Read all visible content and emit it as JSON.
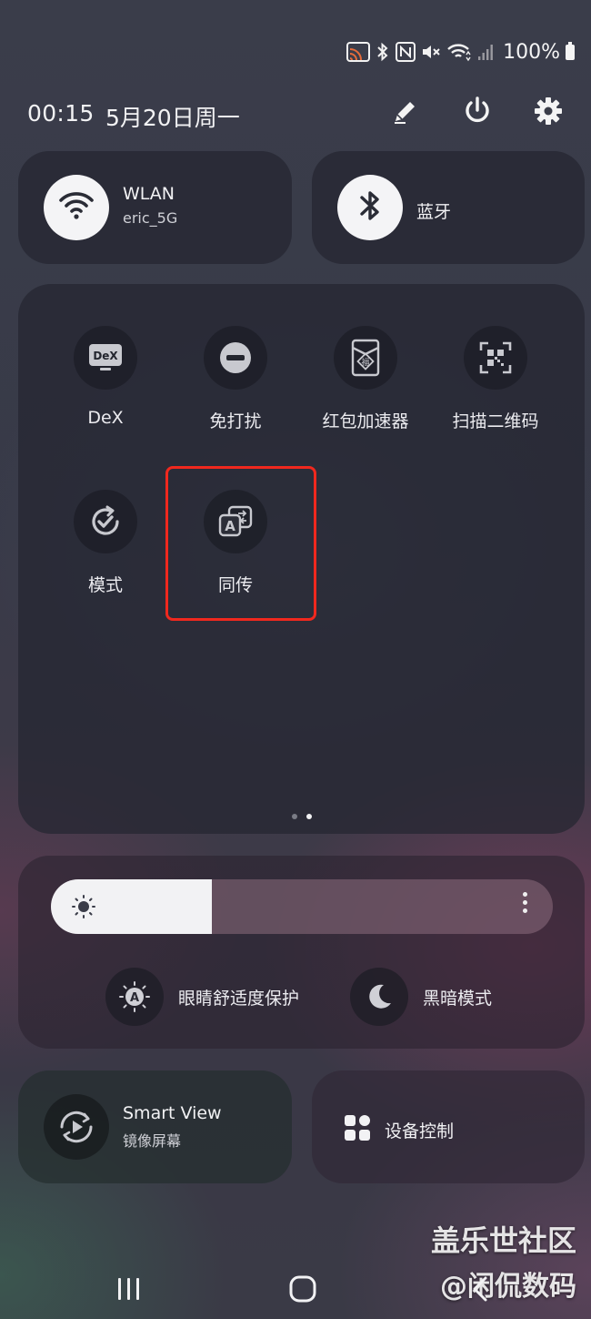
{
  "status_bar": {
    "icons": [
      "cast-icon",
      "bluetooth-icon",
      "nfc-icon",
      "mute-icon",
      "wifi-icon",
      "signal-icon"
    ],
    "battery_text": "100%"
  },
  "header": {
    "time": "00:15",
    "date": "5月20日周一",
    "actions": [
      "pencil-icon",
      "power-icon",
      "gear-icon"
    ]
  },
  "wlan": {
    "title": "WLAN",
    "network": "eric_5G"
  },
  "bluetooth": {
    "title": "蓝牙"
  },
  "quick_tiles": [
    {
      "label": "DeX",
      "icon": "dex-icon",
      "icon_text": "DeX"
    },
    {
      "label": "免打扰",
      "icon": "do-not-disturb-icon"
    },
    {
      "label": "红包加速器",
      "icon": "red-envelope-icon",
      "icon_text": "福"
    },
    {
      "label": "扫描二维码",
      "icon": "qr-scan-icon"
    },
    {
      "label": "模式",
      "icon": "modes-icon"
    },
    {
      "label": "同传",
      "icon": "translate-icon",
      "icon_text": "A"
    }
  ],
  "pager": {
    "total": 2,
    "current": 2
  },
  "brightness": {
    "level": 0.32
  },
  "display_options": [
    {
      "label": "眼睛舒适度保护",
      "icon": "eye-comfort-icon",
      "icon_text": "A"
    },
    {
      "label": "黑暗模式",
      "icon": "moon-icon"
    }
  ],
  "smart_view": {
    "title": "Smart View",
    "subtitle": "镜像屏幕"
  },
  "device_control": {
    "title": "设备控制"
  },
  "watermark": {
    "line1": "盖乐世社区",
    "line2": "@闲侃数码"
  },
  "colors": {
    "highlight": "#f0281e",
    "tile_bg": "#1f212a",
    "toggle_on": "#f4f4f6"
  }
}
